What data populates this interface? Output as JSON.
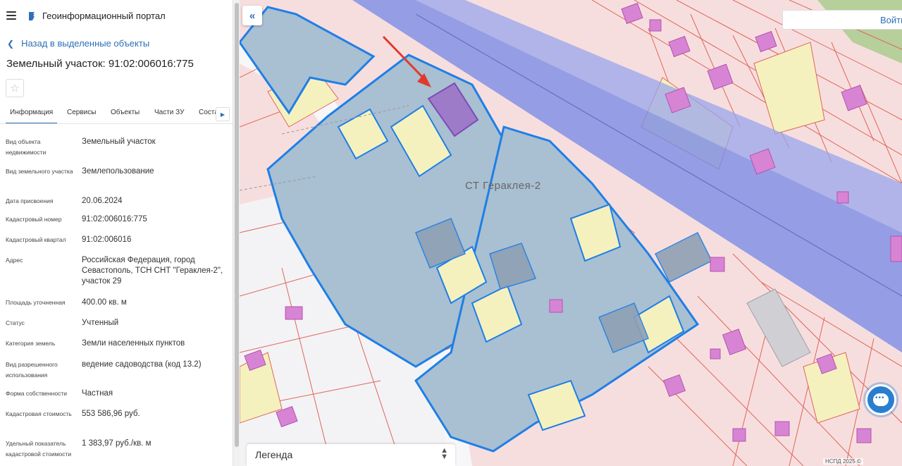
{
  "app": {
    "title": "Геоинформационный портал",
    "back_link": "Назад в выделенные объекты",
    "object_title": "Земельный участок: 91:02:006016:775"
  },
  "tabs": [
    {
      "label": "Информация",
      "active": true
    },
    {
      "label": "Сервисы",
      "active": false
    },
    {
      "label": "Объекты",
      "active": false
    },
    {
      "label": "Части ЗУ",
      "active": false
    },
    {
      "label": "Соста",
      "active": false
    }
  ],
  "properties": [
    {
      "label": "Вид объекта недвижимости",
      "value": "Земельный участок"
    },
    {
      "label": "Вид земельного участка",
      "value": "Землепользование"
    },
    {
      "label": "Дата присвоения",
      "value": "20.06.2024"
    },
    {
      "label": "Кадастровый номер",
      "value": "91:02:006016:775"
    },
    {
      "label": "Кадастровый квартал",
      "value": "91:02:006016"
    },
    {
      "label": "Адрес",
      "value": "Российская Федерация, город Севастополь, ТСН СНТ \"Гераклея-2\", участок 29"
    },
    {
      "label": "Площадь уточненная",
      "value": "400.00 кв. м"
    },
    {
      "label": "Статус",
      "value": "Учтенный"
    },
    {
      "label": "Категория земель",
      "value": "Земли населенных пунктов"
    },
    {
      "label": "Вид разрешенного использования",
      "value": "ведение садоводства (код 13.2)"
    },
    {
      "label": "Форма собственности",
      "value": "Частная"
    },
    {
      "label": "Кадастровая стоимость",
      "value": "553 586,96 руб."
    },
    {
      "label": "Удельный показатель кадастровой стоимости",
      "value": "1 383,97 руб./кв. м"
    }
  ],
  "map": {
    "login_label": "Войти",
    "area_label": "СТ Гераклея-2",
    "legend_label": "Легенда",
    "attribution": "НСПД 2025 ©",
    "colors": {
      "parcel_fill": "#f7dede",
      "parcel_border": "#e0645a",
      "highlight_border": "#1e7fe6",
      "road_band": "#7c8ce6",
      "selected": "#9e7bc8",
      "building": "#d884d4"
    }
  },
  "icons": {
    "menu": "menu-icon",
    "logo": "logo-icon",
    "back": "chevron-left-icon",
    "favorite": "star-icon",
    "collapse": "double-chevron-left-icon",
    "chat": "chat-icon"
  }
}
